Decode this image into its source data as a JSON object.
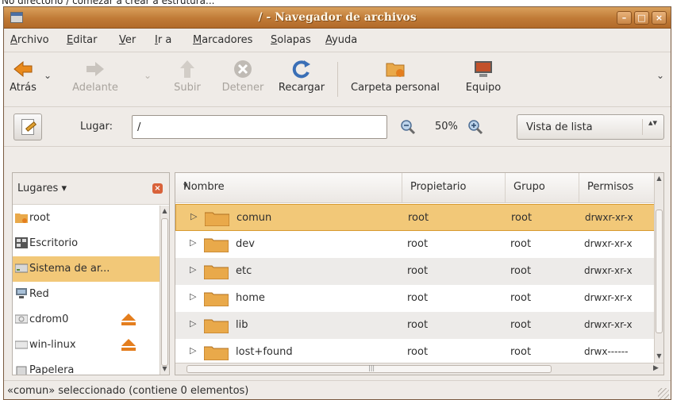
{
  "caption": "No directorio / comezar a crear a estrutura...",
  "window": {
    "title": "/ - Navegador de archivos",
    "controls": {
      "minimize": "–",
      "maximize": "□",
      "close": "×"
    }
  },
  "menubar": {
    "items": [
      {
        "label": "Archivo",
        "mnemonic": "A",
        "rest": "rchivo"
      },
      {
        "label": "Editar",
        "mnemonic": "E",
        "rest": "ditar"
      },
      {
        "label": "Ver",
        "mnemonic": "V",
        "rest": "er"
      },
      {
        "label": "Ir a",
        "mnemonic": "I",
        "rest": "r a"
      },
      {
        "label": "Marcadores",
        "mnemonic": "M",
        "rest": "arcadores"
      },
      {
        "label": "Solapas",
        "mnemonic": "S",
        "rest": "olapas"
      },
      {
        "label": "Ayuda",
        "mnemonic": "A",
        "rest": "yuda"
      }
    ]
  },
  "toolbar": {
    "back": "Atrás",
    "forward": "Adelante",
    "up": "Subir",
    "stop": "Detener",
    "reload": "Recargar",
    "home": "Carpeta personal",
    "computer": "Equipo",
    "drop_arrow": "⌄"
  },
  "location": {
    "label": "Lugar:",
    "value": "/",
    "zoom": "50%",
    "view": "Vista de lista",
    "view_arrows": "▴▾"
  },
  "sidebar": {
    "title": "Lugares",
    "title_arrow": "▾",
    "close": "×",
    "items": [
      {
        "label": "root",
        "icon": "home-folder-icon"
      },
      {
        "label": "Escritorio",
        "icon": "desktop-icon"
      },
      {
        "label": "Sistema de ar...",
        "icon": "filesystem-icon",
        "selected": true
      },
      {
        "label": "Red",
        "icon": "network-icon"
      },
      {
        "label": "cdrom0",
        "icon": "cdrom-icon",
        "eject": true
      },
      {
        "label": "win-linux",
        "icon": "drive-icon",
        "eject": true
      },
      {
        "label": "Papelera",
        "icon": "trash-icon"
      }
    ]
  },
  "filelist": {
    "columns": {
      "name": "Nombre",
      "owner": "Propietario",
      "group": "Grupo",
      "perms": "Permisos",
      "sort_arrow": "▾"
    },
    "rows": [
      {
        "name": "comun",
        "owner": "root",
        "group": "root",
        "perms": "drwxr-xr-x",
        "selected": true
      },
      {
        "name": "dev",
        "owner": "root",
        "group": "root",
        "perms": "drwxr-xr-x"
      },
      {
        "name": "etc",
        "owner": "root",
        "group": "root",
        "perms": "drwxr-xr-x"
      },
      {
        "name": "home",
        "owner": "root",
        "group": "root",
        "perms": "drwxr-xr-x"
      },
      {
        "name": "lib",
        "owner": "root",
        "group": "root",
        "perms": "drwxr-xr-x"
      },
      {
        "name": "lost+found",
        "owner": "root",
        "group": "root",
        "perms": "drwx------"
      }
    ],
    "expander": "▷"
  },
  "status": {
    "text": "«comun» seleccionado (contiene 0 elementos)"
  },
  "colors": {
    "titlebar": "#c07a36",
    "selection": "#f2c878",
    "folder": "#e9a94a",
    "accent": "#e47e1e"
  }
}
